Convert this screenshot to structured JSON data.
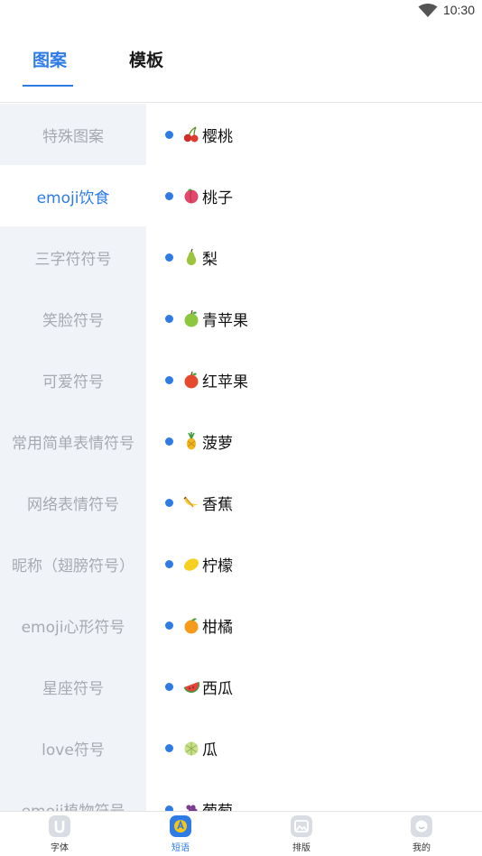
{
  "status": {
    "time": "10:30"
  },
  "tabs": [
    {
      "label": "图案",
      "active": true
    },
    {
      "label": "模板",
      "active": false
    }
  ],
  "sidebar": {
    "items": [
      {
        "label": "特殊图案",
        "active": false
      },
      {
        "label": "emoji饮食",
        "active": true
      },
      {
        "label": "三字符符号",
        "active": false
      },
      {
        "label": "笑脸符号",
        "active": false
      },
      {
        "label": "可爱符号",
        "active": false
      },
      {
        "label": "常用简单表情符号",
        "active": false
      },
      {
        "label": "网络表情符号",
        "active": false
      },
      {
        "label": "昵称（翅膀符号）",
        "active": false
      },
      {
        "label": "emoji心形符号",
        "active": false
      },
      {
        "label": "星座符号",
        "active": false
      },
      {
        "label": "love符号",
        "active": false
      },
      {
        "label": "emoji植物符号",
        "active": false
      }
    ]
  },
  "content": {
    "items": [
      {
        "label": "樱桃",
        "icon": "cherry-icon"
      },
      {
        "label": "桃子",
        "icon": "peach-icon"
      },
      {
        "label": "梨",
        "icon": "pear-icon"
      },
      {
        "label": "青苹果",
        "icon": "green-apple-icon"
      },
      {
        "label": "红苹果",
        "icon": "red-apple-icon"
      },
      {
        "label": "菠萝",
        "icon": "pineapple-icon"
      },
      {
        "label": "香蕉",
        "icon": "banana-icon"
      },
      {
        "label": "柠檬",
        "icon": "lemon-icon"
      },
      {
        "label": "柑橘",
        "icon": "tangerine-icon"
      },
      {
        "label": "西瓜",
        "icon": "watermelon-icon"
      },
      {
        "label": "瓜",
        "icon": "melon-icon"
      },
      {
        "label": "葡萄",
        "icon": "grapes-icon"
      }
    ]
  },
  "bottom_nav": [
    {
      "label": "字体",
      "icon": "font-icon",
      "active": false
    },
    {
      "label": "短语",
      "icon": "phrase-icon",
      "active": true
    },
    {
      "label": "排版",
      "icon": "image-icon",
      "active": false
    },
    {
      "label": "我的",
      "icon": "profile-icon",
      "active": false
    }
  ],
  "colors": {
    "accent": "#2f7be5",
    "sidebar_bg": "#f0f3f8",
    "sidebar_text": "#a7aab0"
  }
}
